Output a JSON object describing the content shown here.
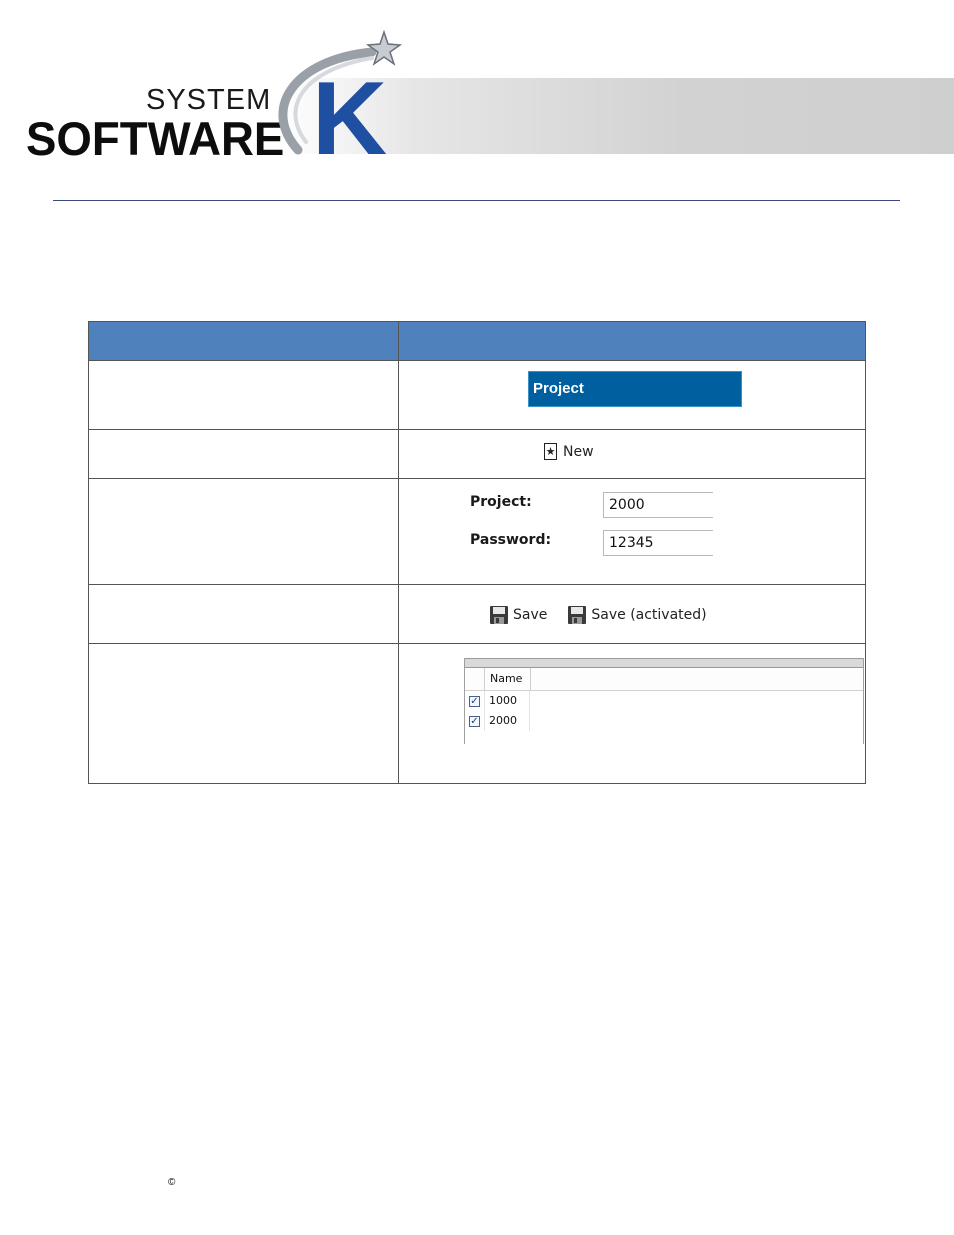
{
  "header": {
    "logo_line1": "SYSTEM",
    "logo_line2": "SOFTWARE",
    "logo_letter": "K",
    "accent_color": "#1e4fa0"
  },
  "table": {
    "header_color": "#4f81bd",
    "rows": [
      {
        "image": "project-tab",
        "tab_label": "Project"
      },
      {
        "image": "new-button",
        "new_label": "New",
        "icon": "star-icon"
      },
      {
        "image": "project-form",
        "project_label": "Project:",
        "project_value": "2000",
        "password_label": "Password:",
        "password_value": "12345"
      },
      {
        "image": "save-buttons",
        "save_label": "Save",
        "save_activated_label": "Save (activated)",
        "icon": "floppy-disk-icon"
      },
      {
        "image": "project-grid",
        "column_name": "Name",
        "items": [
          {
            "name": "1000",
            "checked": true
          },
          {
            "name": "2000",
            "checked": true
          }
        ]
      }
    ]
  },
  "footer": {
    "copyright_symbol": "©"
  }
}
